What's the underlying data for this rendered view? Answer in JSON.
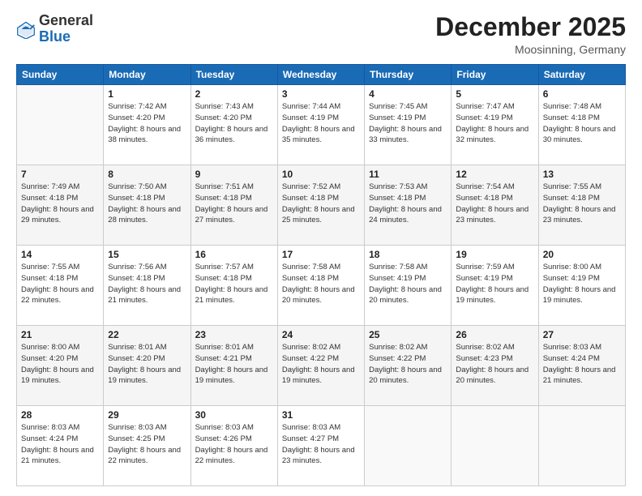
{
  "header": {
    "logo": {
      "general": "General",
      "blue": "Blue"
    },
    "title": "December 2025",
    "location": "Moosinning, Germany"
  },
  "days_of_week": [
    "Sunday",
    "Monday",
    "Tuesday",
    "Wednesday",
    "Thursday",
    "Friday",
    "Saturday"
  ],
  "weeks": [
    [
      {
        "day": "",
        "empty": true
      },
      {
        "day": "1",
        "sunrise": "Sunrise: 7:42 AM",
        "sunset": "Sunset: 4:20 PM",
        "daylight": "Daylight: 8 hours and 38 minutes."
      },
      {
        "day": "2",
        "sunrise": "Sunrise: 7:43 AM",
        "sunset": "Sunset: 4:20 PM",
        "daylight": "Daylight: 8 hours and 36 minutes."
      },
      {
        "day": "3",
        "sunrise": "Sunrise: 7:44 AM",
        "sunset": "Sunset: 4:19 PM",
        "daylight": "Daylight: 8 hours and 35 minutes."
      },
      {
        "day": "4",
        "sunrise": "Sunrise: 7:45 AM",
        "sunset": "Sunset: 4:19 PM",
        "daylight": "Daylight: 8 hours and 33 minutes."
      },
      {
        "day": "5",
        "sunrise": "Sunrise: 7:47 AM",
        "sunset": "Sunset: 4:19 PM",
        "daylight": "Daylight: 8 hours and 32 minutes."
      },
      {
        "day": "6",
        "sunrise": "Sunrise: 7:48 AM",
        "sunset": "Sunset: 4:18 PM",
        "daylight": "Daylight: 8 hours and 30 minutes."
      }
    ],
    [
      {
        "day": "7",
        "sunrise": "Sunrise: 7:49 AM",
        "sunset": "Sunset: 4:18 PM",
        "daylight": "Daylight: 8 hours and 29 minutes."
      },
      {
        "day": "8",
        "sunrise": "Sunrise: 7:50 AM",
        "sunset": "Sunset: 4:18 PM",
        "daylight": "Daylight: 8 hours and 28 minutes."
      },
      {
        "day": "9",
        "sunrise": "Sunrise: 7:51 AM",
        "sunset": "Sunset: 4:18 PM",
        "daylight": "Daylight: 8 hours and 27 minutes."
      },
      {
        "day": "10",
        "sunrise": "Sunrise: 7:52 AM",
        "sunset": "Sunset: 4:18 PM",
        "daylight": "Daylight: 8 hours and 25 minutes."
      },
      {
        "day": "11",
        "sunrise": "Sunrise: 7:53 AM",
        "sunset": "Sunset: 4:18 PM",
        "daylight": "Daylight: 8 hours and 24 minutes."
      },
      {
        "day": "12",
        "sunrise": "Sunrise: 7:54 AM",
        "sunset": "Sunset: 4:18 PM",
        "daylight": "Daylight: 8 hours and 23 minutes."
      },
      {
        "day": "13",
        "sunrise": "Sunrise: 7:55 AM",
        "sunset": "Sunset: 4:18 PM",
        "daylight": "Daylight: 8 hours and 23 minutes."
      }
    ],
    [
      {
        "day": "14",
        "sunrise": "Sunrise: 7:55 AM",
        "sunset": "Sunset: 4:18 PM",
        "daylight": "Daylight: 8 hours and 22 minutes."
      },
      {
        "day": "15",
        "sunrise": "Sunrise: 7:56 AM",
        "sunset": "Sunset: 4:18 PM",
        "daylight": "Daylight: 8 hours and 21 minutes."
      },
      {
        "day": "16",
        "sunrise": "Sunrise: 7:57 AM",
        "sunset": "Sunset: 4:18 PM",
        "daylight": "Daylight: 8 hours and 21 minutes."
      },
      {
        "day": "17",
        "sunrise": "Sunrise: 7:58 AM",
        "sunset": "Sunset: 4:18 PM",
        "daylight": "Daylight: 8 hours and 20 minutes."
      },
      {
        "day": "18",
        "sunrise": "Sunrise: 7:58 AM",
        "sunset": "Sunset: 4:19 PM",
        "daylight": "Daylight: 8 hours and 20 minutes."
      },
      {
        "day": "19",
        "sunrise": "Sunrise: 7:59 AM",
        "sunset": "Sunset: 4:19 PM",
        "daylight": "Daylight: 8 hours and 19 minutes."
      },
      {
        "day": "20",
        "sunrise": "Sunrise: 8:00 AM",
        "sunset": "Sunset: 4:19 PM",
        "daylight": "Daylight: 8 hours and 19 minutes."
      }
    ],
    [
      {
        "day": "21",
        "sunrise": "Sunrise: 8:00 AM",
        "sunset": "Sunset: 4:20 PM",
        "daylight": "Daylight: 8 hours and 19 minutes."
      },
      {
        "day": "22",
        "sunrise": "Sunrise: 8:01 AM",
        "sunset": "Sunset: 4:20 PM",
        "daylight": "Daylight: 8 hours and 19 minutes."
      },
      {
        "day": "23",
        "sunrise": "Sunrise: 8:01 AM",
        "sunset": "Sunset: 4:21 PM",
        "daylight": "Daylight: 8 hours and 19 minutes."
      },
      {
        "day": "24",
        "sunrise": "Sunrise: 8:02 AM",
        "sunset": "Sunset: 4:22 PM",
        "daylight": "Daylight: 8 hours and 19 minutes."
      },
      {
        "day": "25",
        "sunrise": "Sunrise: 8:02 AM",
        "sunset": "Sunset: 4:22 PM",
        "daylight": "Daylight: 8 hours and 20 minutes."
      },
      {
        "day": "26",
        "sunrise": "Sunrise: 8:02 AM",
        "sunset": "Sunset: 4:23 PM",
        "daylight": "Daylight: 8 hours and 20 minutes."
      },
      {
        "day": "27",
        "sunrise": "Sunrise: 8:03 AM",
        "sunset": "Sunset: 4:24 PM",
        "daylight": "Daylight: 8 hours and 21 minutes."
      }
    ],
    [
      {
        "day": "28",
        "sunrise": "Sunrise: 8:03 AM",
        "sunset": "Sunset: 4:24 PM",
        "daylight": "Daylight: 8 hours and 21 minutes."
      },
      {
        "day": "29",
        "sunrise": "Sunrise: 8:03 AM",
        "sunset": "Sunset: 4:25 PM",
        "daylight": "Daylight: 8 hours and 22 minutes."
      },
      {
        "day": "30",
        "sunrise": "Sunrise: 8:03 AM",
        "sunset": "Sunset: 4:26 PM",
        "daylight": "Daylight: 8 hours and 22 minutes."
      },
      {
        "day": "31",
        "sunrise": "Sunrise: 8:03 AM",
        "sunset": "Sunset: 4:27 PM",
        "daylight": "Daylight: 8 hours and 23 minutes."
      },
      {
        "day": "",
        "empty": true
      },
      {
        "day": "",
        "empty": true
      },
      {
        "day": "",
        "empty": true
      }
    ]
  ]
}
